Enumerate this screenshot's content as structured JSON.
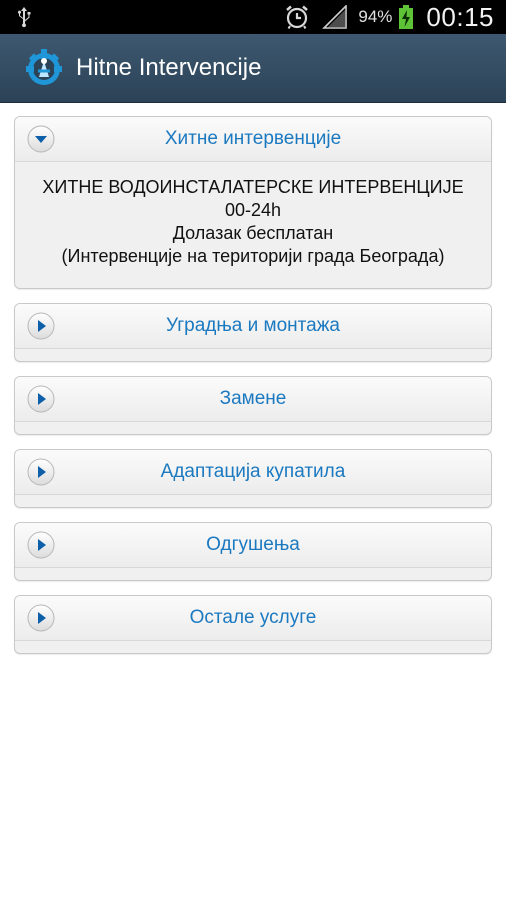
{
  "status_bar": {
    "battery_percent": "94%",
    "time": "00:15"
  },
  "app": {
    "title": "Hitne Intervencije"
  },
  "sections": [
    {
      "label": "Хитне интервенције",
      "expanded": true,
      "body": [
        "ХИТНЕ ВОДОИНСТАЛАТЕРСКЕ ИНТЕРВЕНЦИЈЕ",
        "00-24h",
        "Долазак бесплатан",
        "(Интервенције на територији града Београда)"
      ]
    },
    {
      "label": "Уградња и монтажа",
      "expanded": false
    },
    {
      "label": "Замене",
      "expanded": false
    },
    {
      "label": "Адаптација купатила",
      "expanded": false
    },
    {
      "label": "Одгушења",
      "expanded": false
    },
    {
      "label": "Остале услуге",
      "expanded": false
    }
  ],
  "colors": {
    "accent": "#1b79c0",
    "action_bar": "#34495e",
    "status_bar": "#000000"
  }
}
